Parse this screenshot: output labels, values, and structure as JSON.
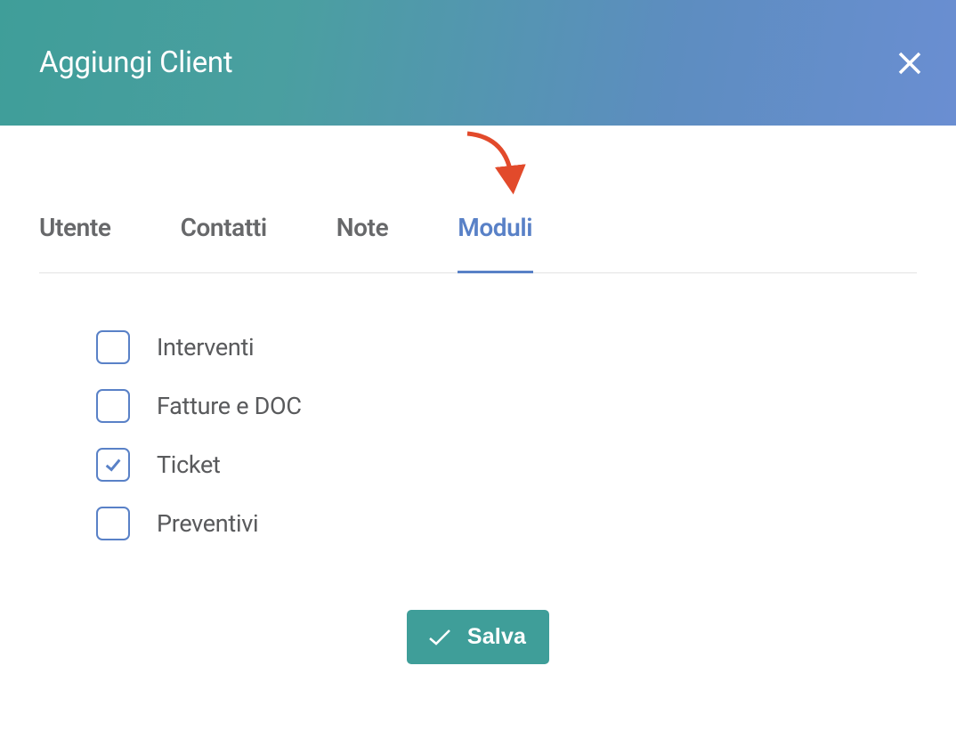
{
  "header": {
    "title": "Aggiungi Client"
  },
  "tabs": [
    {
      "label": "Utente",
      "active": false
    },
    {
      "label": "Contatti",
      "active": false
    },
    {
      "label": "Note",
      "active": false
    },
    {
      "label": "Moduli",
      "active": true
    }
  ],
  "options": [
    {
      "label": "Interventi",
      "checked": false
    },
    {
      "label": "Fatture e DOC",
      "checked": false
    },
    {
      "label": "Ticket",
      "checked": true
    },
    {
      "label": "Preventivi",
      "checked": false
    }
  ],
  "buttons": {
    "save": "Salva"
  }
}
